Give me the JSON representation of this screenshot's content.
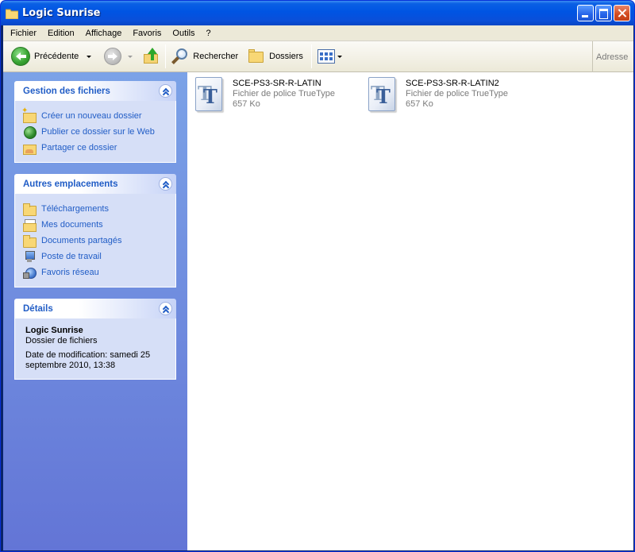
{
  "window": {
    "title": "Logic Sunrise"
  },
  "menubar": {
    "items": [
      "Fichier",
      "Edition",
      "Affichage",
      "Favoris",
      "Outils",
      "?"
    ]
  },
  "toolbar": {
    "back_label": "Précédente",
    "search_label": "Rechercher",
    "folders_label": "Dossiers",
    "address_label": "Adresse"
  },
  "taskpane": {
    "file_tasks": {
      "title": "Gestion des fichiers",
      "items": [
        {
          "label": "Créer un nouveau dossier",
          "icon": "new-folder-icon"
        },
        {
          "label": "Publier ce dossier sur le Web",
          "icon": "globe-icon"
        },
        {
          "label": "Partager ce dossier",
          "icon": "share-folder-icon"
        }
      ]
    },
    "other_places": {
      "title": "Autres emplacements",
      "items": [
        {
          "label": "Téléchargements",
          "icon": "folder-icon"
        },
        {
          "label": "Mes documents",
          "icon": "my-documents-icon"
        },
        {
          "label": "Documents partagés",
          "icon": "folder-icon"
        },
        {
          "label": "Poste de travail",
          "icon": "computer-icon"
        },
        {
          "label": "Favoris réseau",
          "icon": "network-icon"
        }
      ]
    },
    "details": {
      "title": "Détails",
      "name": "Logic Sunrise",
      "type": "Dossier de fichiers",
      "modified": "Date de modification: samedi 25 septembre 2010, 13:38"
    }
  },
  "files": [
    {
      "name": "SCE-PS3-SR-R-LATIN",
      "type": "Fichier de police TrueType",
      "size": "657 Ko",
      "icon": "truetype-font-icon"
    },
    {
      "name": "SCE-PS3-SR-R-LATIN2",
      "type": "Fichier de police TrueType",
      "size": "657 Ko",
      "icon": "truetype-font-icon"
    }
  ],
  "colors": {
    "titlebar": "#0054e3",
    "taskpane_top": "#7ba2e7",
    "taskpane_bottom": "#6375d6",
    "link": "#215dc6"
  }
}
